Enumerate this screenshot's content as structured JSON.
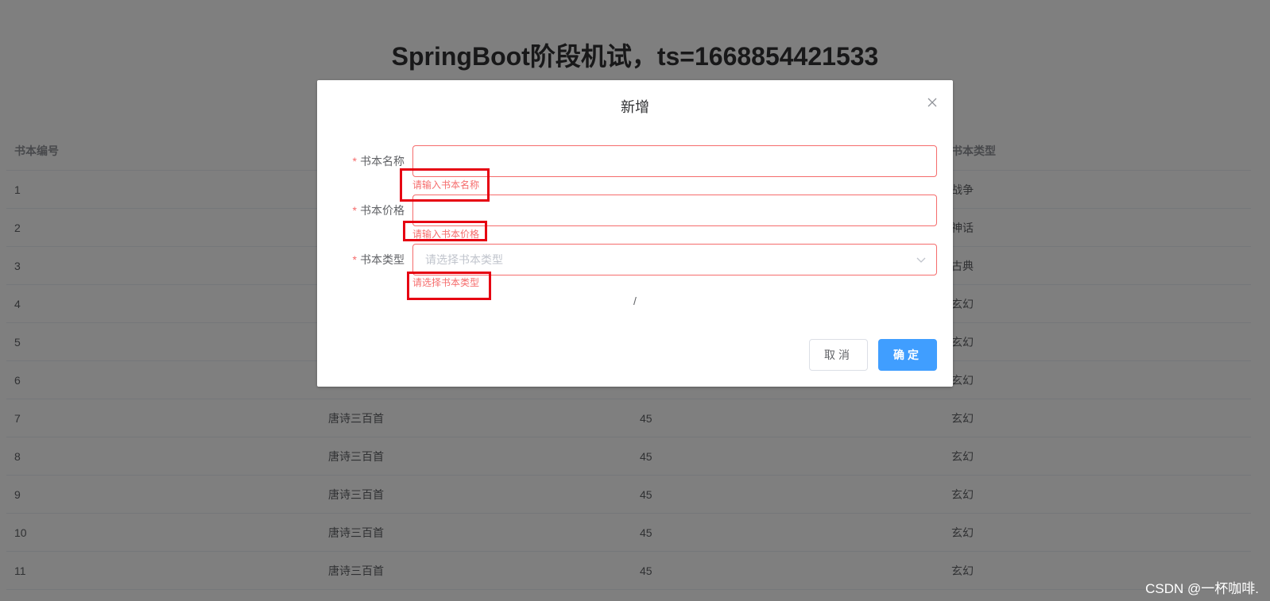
{
  "page": {
    "title": "SpringBoot阶段机试，ts=1668854421533"
  },
  "table": {
    "headers": [
      "书本编号",
      "",
      "",
      "书本类型"
    ],
    "rows": [
      [
        "1",
        "",
        "",
        "战争"
      ],
      [
        "2",
        "",
        "",
        "神话"
      ],
      [
        "3",
        "",
        "",
        "古典"
      ],
      [
        "4",
        "",
        "",
        "玄幻"
      ],
      [
        "5",
        "",
        "",
        "玄幻"
      ],
      [
        "6",
        "",
        "",
        "玄幻"
      ],
      [
        "7",
        "唐诗三百首",
        "45",
        "玄幻"
      ],
      [
        "8",
        "唐诗三百首",
        "45",
        "玄幻"
      ],
      [
        "9",
        "唐诗三百首",
        "45",
        "玄幻"
      ],
      [
        "10",
        "唐诗三百首",
        "45",
        "玄幻"
      ],
      [
        "11",
        "唐诗三百首",
        "45",
        "玄幻"
      ]
    ]
  },
  "dialog": {
    "title": "新增",
    "close_icon": "close-icon",
    "required_mark": "*",
    "fields": {
      "name": {
        "label": "书本名称",
        "value": "",
        "error": "请输入书本名称"
      },
      "price": {
        "label": "书本价格",
        "value": "",
        "error": "请输入书本价格"
      },
      "type": {
        "label": "书本类型",
        "placeholder": "请选择书本类型",
        "error": "请选择书本类型",
        "icon": "chevron-down-icon"
      }
    },
    "separator": "/",
    "cancel_label": "取消",
    "confirm_label": "确定"
  },
  "watermark": "CSDN @一杯咖啡.",
  "colors": {
    "error": "#f56c6c",
    "primary": "#409eff",
    "annotation": "#e60012"
  }
}
